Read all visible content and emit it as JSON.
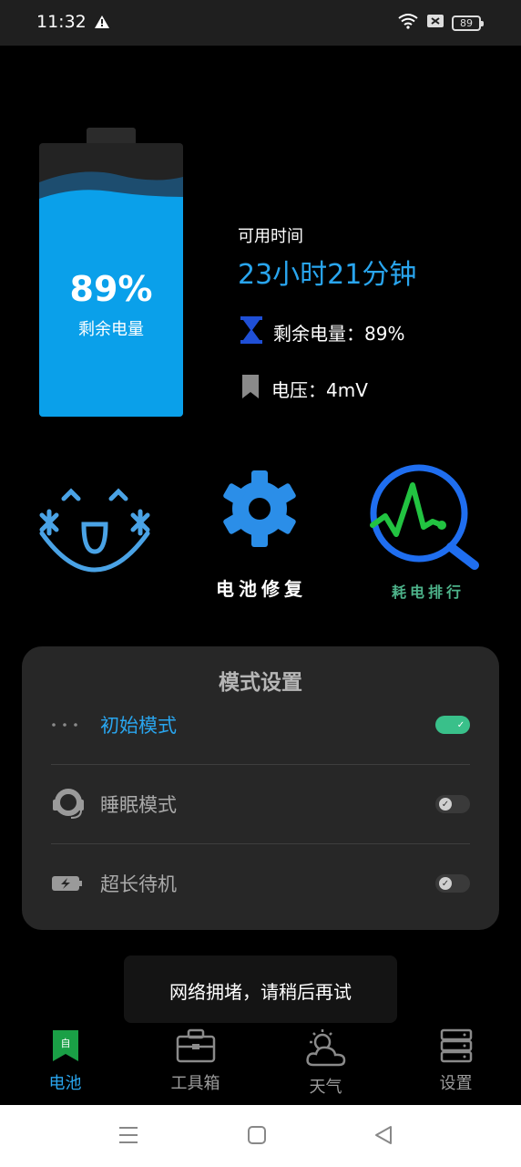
{
  "status_bar": {
    "time": "11:32",
    "battery_level": "89"
  },
  "battery_panel": {
    "percent": "89%",
    "fill_fraction": 0.89,
    "label": "剩余电量",
    "colors": {
      "fill": "#0aa0ea",
      "wave_dark": "#1d4d6f",
      "case": "#232323"
    }
  },
  "info": {
    "available_label": "可用时间",
    "available_value": "23小时21分钟",
    "remaining_text": "剩余电量：89%",
    "voltage_text": "电压：4mV"
  },
  "actions": [
    {
      "icon": "smiley-face-icon",
      "label": ""
    },
    {
      "icon": "gear-icon",
      "label": "电池修复"
    },
    {
      "icon": "power-analysis-icon",
      "label": "耗电排行"
    }
  ],
  "mode_settings": {
    "title": "模式设置",
    "modes": [
      {
        "icon": "dots-icon",
        "label": "初始模式",
        "enabled": true
      },
      {
        "icon": "headset-icon",
        "label": "睡眠模式",
        "enabled": false
      },
      {
        "icon": "battery-charging-icon",
        "label": "超长待机",
        "enabled": false
      }
    ]
  },
  "toast": "网络拥堵，请稍后再试",
  "bottom_nav": [
    {
      "icon": "battery-bookmark-icon",
      "label": "电池",
      "active": true
    },
    {
      "icon": "toolbox-icon",
      "label": "工具箱",
      "active": false
    },
    {
      "icon": "weather-icon",
      "label": "天气",
      "active": false
    },
    {
      "icon": "server-icon",
      "label": "设置",
      "active": false
    }
  ],
  "accent_color": "#29a5ee"
}
